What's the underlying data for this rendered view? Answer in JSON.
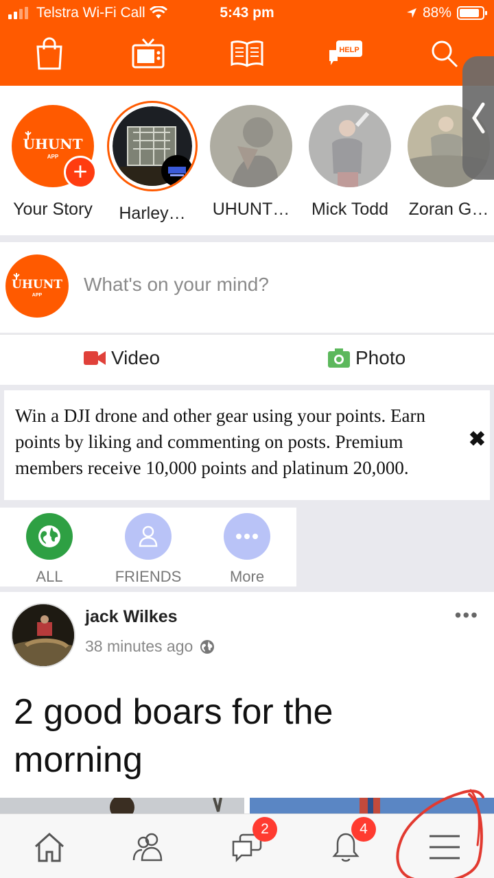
{
  "status_bar": {
    "carrier": "Telstra Wi-Fi Call",
    "time": "5:43 pm",
    "battery": "88%",
    "battery_level": 0.88
  },
  "toolbar": {
    "icons": [
      "shopping-bag-icon",
      "tv-icon",
      "book-icon",
      "help-icon",
      "search-icon"
    ],
    "help_label": "HELP"
  },
  "brand": {
    "accent": "#ff5a00",
    "logo_text": "UHUNT",
    "logo_subtext": "APP"
  },
  "stories": [
    {
      "name": "Your Story"
    },
    {
      "name": "Harley…"
    },
    {
      "name": "UHUNT…"
    },
    {
      "name": "Mick Todd"
    },
    {
      "name": "Zoran G…"
    }
  ],
  "composer": {
    "placeholder": "What's on your mind?",
    "video_label": "Video",
    "photo_label": "Photo"
  },
  "promo": {
    "text": "Win a DJI drone and other gear using your points. Earn points by liking and commenting on posts. Premium members receive 10,000 points and platinum 20,000."
  },
  "filters": [
    {
      "label": "ALL",
      "color": "#2ea043"
    },
    {
      "label": "FRIENDS",
      "color": "#b9c3f7"
    },
    {
      "label": "More",
      "color": "#b9c3f7"
    }
  ],
  "post": {
    "author": "jack Wilkes",
    "time": "38 minutes ago",
    "text": "2 good boars for the morning"
  },
  "bottom_nav": {
    "messages_badge": "2",
    "notifications_badge": "4"
  }
}
